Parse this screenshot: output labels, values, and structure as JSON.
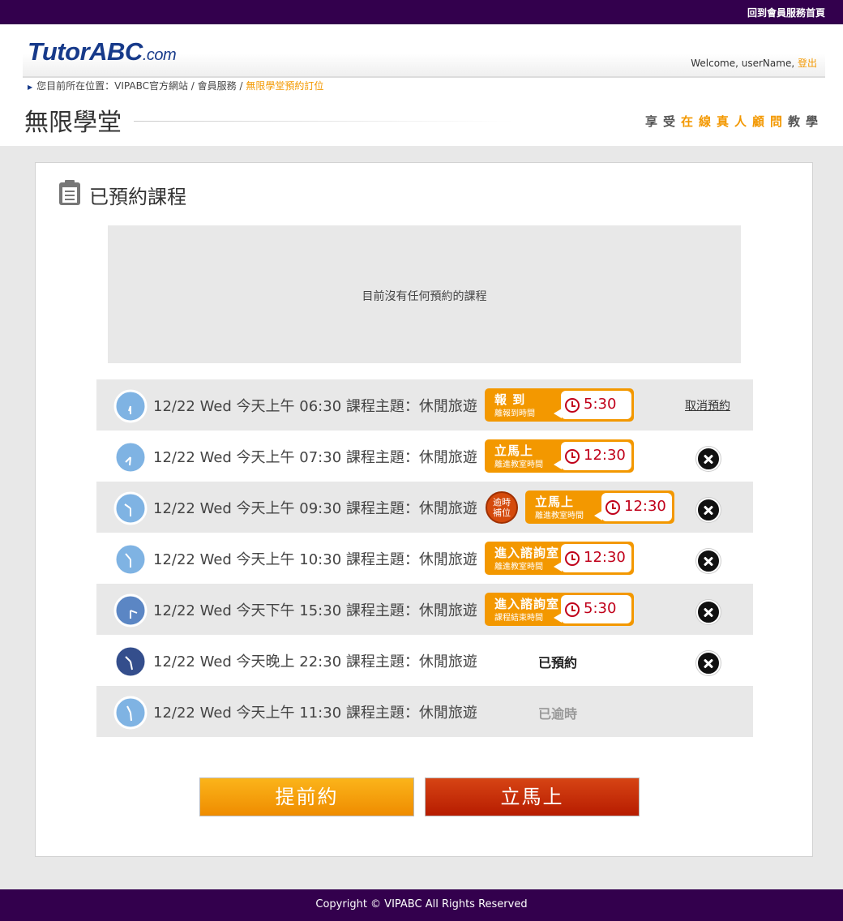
{
  "topbar": {
    "home_link": "回到會員服務首頁"
  },
  "header": {
    "logo_main": "Tutor",
    "logo_o": "ABC",
    "logo_domain": ".com",
    "welcome": "Welcome, userName,",
    "logout": "登出",
    "breadcrumb_path": "您目前所在位置：VIPABC官方網站 / 會員服務 / ",
    "breadcrumb_current": "無限學堂預約訂位",
    "page_title": "無限學堂",
    "slogan_pre": "享受",
    "slogan_hl": "在線真人顧問",
    "slogan_post": "教學"
  },
  "panel": {
    "title": "已預約課程",
    "empty_message": "目前沒有任何預約的課程"
  },
  "rows": [
    {
      "text": "12/22 Wed 今天上午 06:30 課程主題：休閒旅遊",
      "badge": "報 到",
      "badge_sub": "離報到時間",
      "time": "5:30",
      "action": "取消預約"
    },
    {
      "text": "12/22 Wed 今天上午 07:30 課程主題：休閒旅遊",
      "badge": "立馬上",
      "badge_sub": "離進教室時間",
      "time": "12:30"
    },
    {
      "text": "12/22 Wed 今天上午 09:30 課程主題：休閒旅遊",
      "late_badge_1": "逾時",
      "late_badge_2": "補位",
      "badge": "立馬上",
      "badge_sub": "離進教室時間",
      "time": "12:30"
    },
    {
      "text": "12/22 Wed 今天上午 10:30 課程主題：休閒旅遊",
      "badge": "進入諮詢室",
      "badge_sub": "離進教室時間",
      "time": "12:30"
    },
    {
      "text": "12/22 Wed 今天下午 15:30 課程主題：休閒旅遊",
      "badge": "進入諮詢室",
      "badge_sub": "課程結束時間",
      "time": "5:30"
    },
    {
      "text": "12/22 Wed 今天晚上 22:30 課程主題：休閒旅遊",
      "status": "已預約"
    },
    {
      "text": "12/22 Wed 今天上午 11:30 課程主題：休閒旅遊",
      "status": "已逾時"
    }
  ],
  "buttons": {
    "early": "提前約",
    "now": "立馬上"
  },
  "footer": {
    "copyright": "Copyright © VIPABC All Rights Reserved"
  },
  "colors": {
    "brand_purple": "#33004d",
    "accent_orange": "#f39800",
    "time_red": "#c0001a"
  }
}
